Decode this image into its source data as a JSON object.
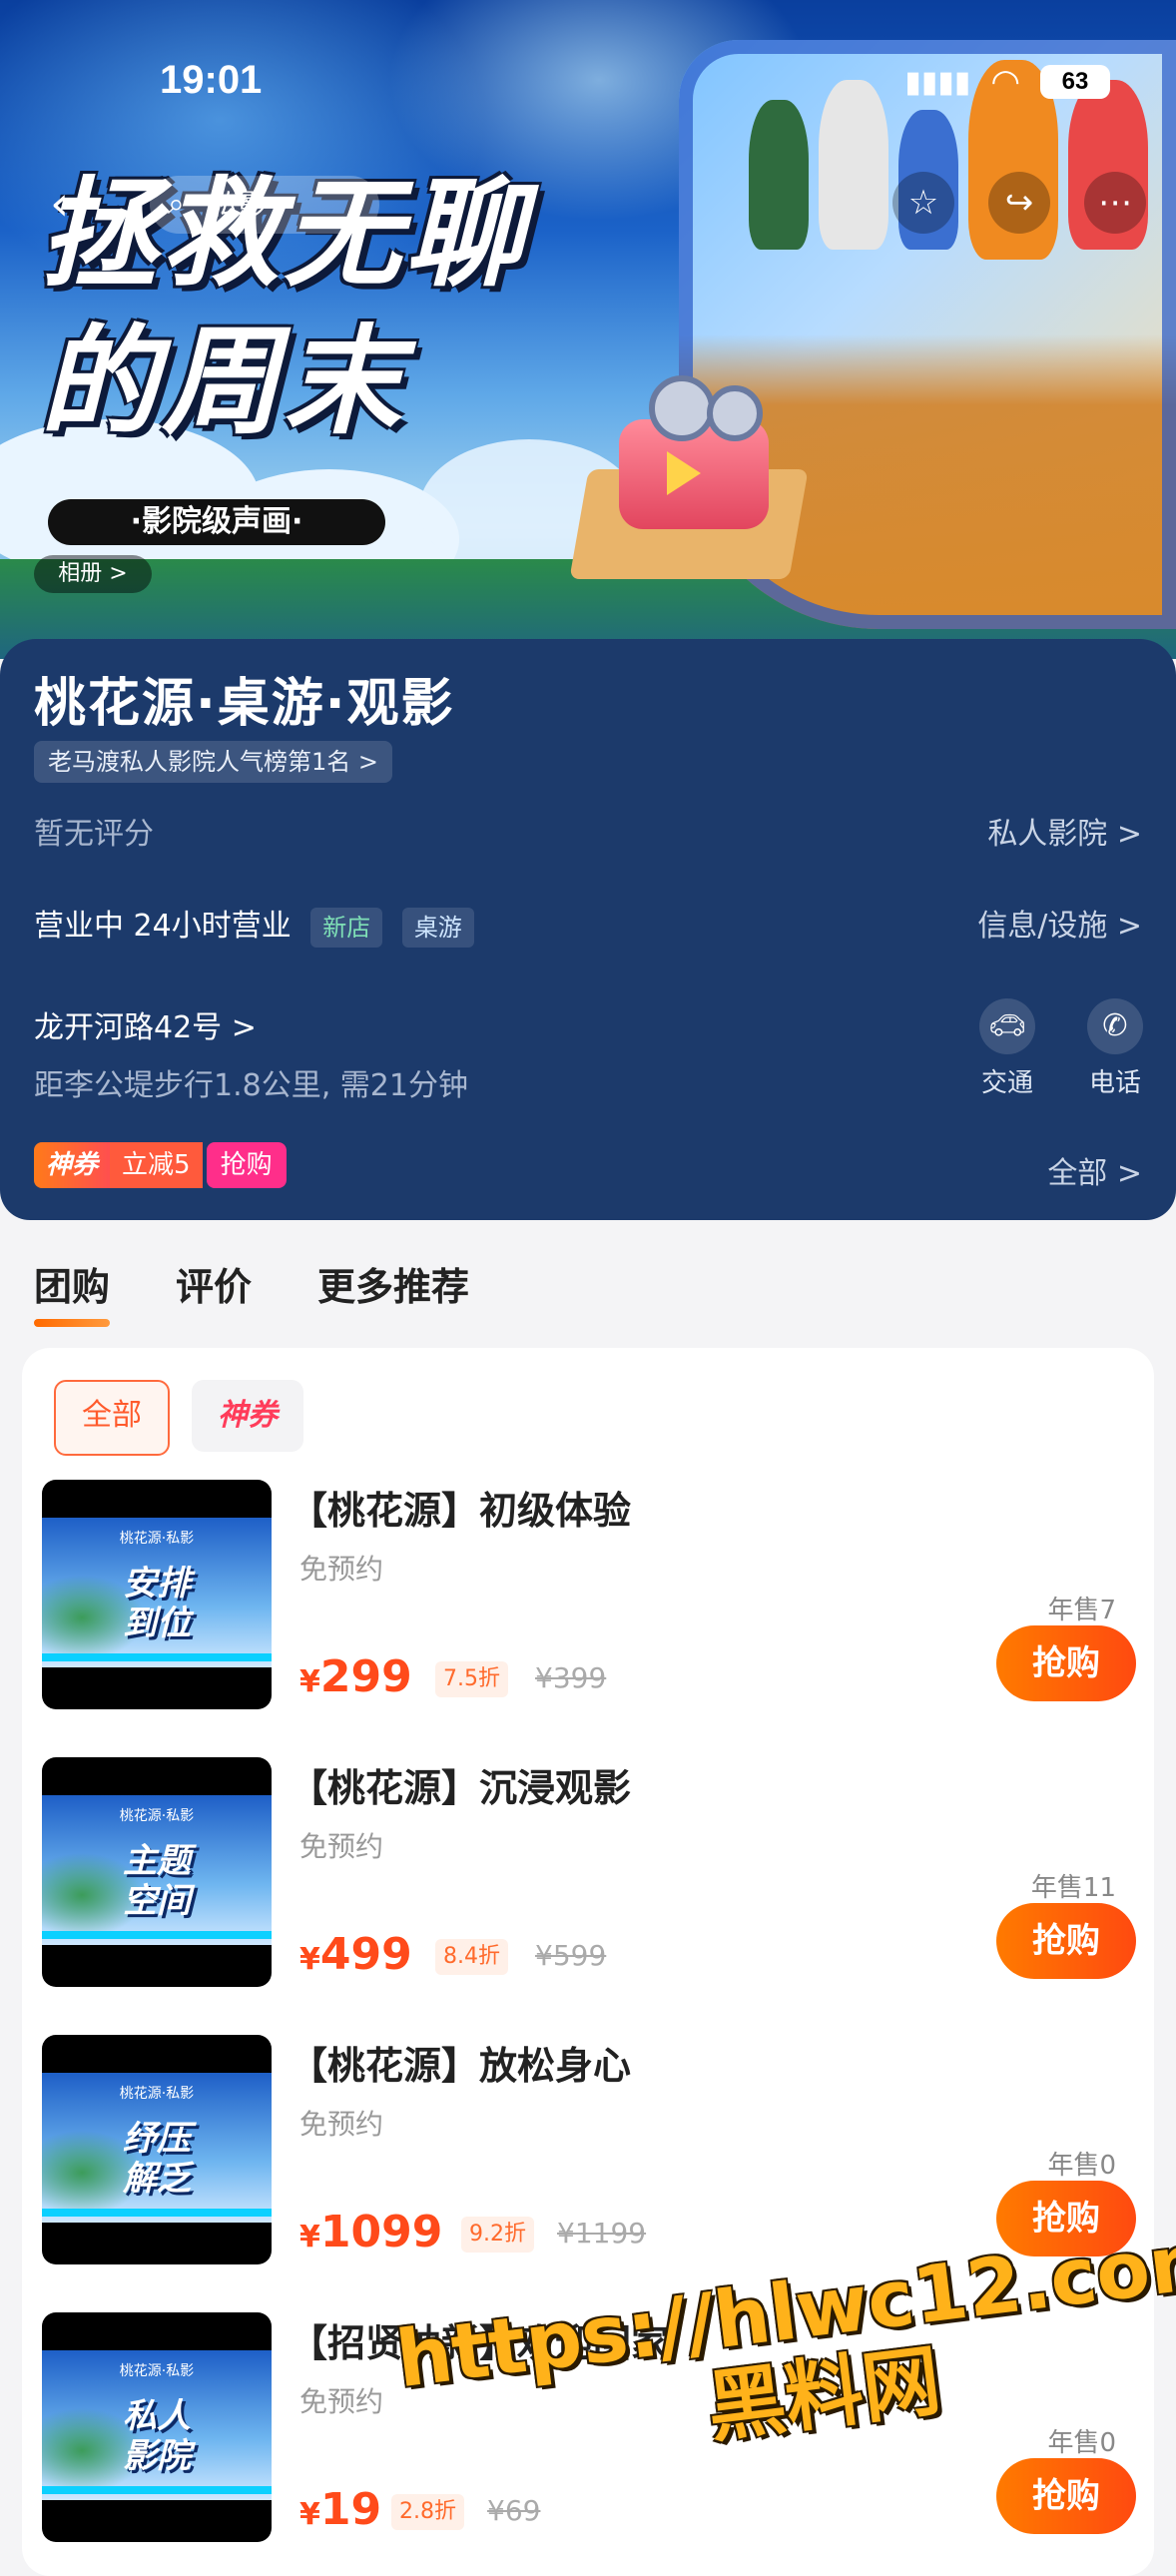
{
  "status_bar": {
    "time": "19:01",
    "battery": "63"
  },
  "nav": {
    "search_placeholder": "私影"
  },
  "hero": {
    "title_line1": "拯救无聊",
    "title_line2": "的周末",
    "pill": "·影院级声画·",
    "album": "相册 >"
  },
  "store": {
    "name": "桃花源·桌游·观影",
    "rank": "老马渡私人影院人气榜第1名 >",
    "rating": "暂无评分",
    "category": "私人影院 >",
    "hours": "营业中 24小时营业",
    "tags": [
      "新店",
      "桌游"
    ],
    "info_link": "信息/设施 >",
    "address": "龙开河路42号 >",
    "distance": "距李公堤步行1.8公里, 需21分钟",
    "actions": {
      "transit": "交通",
      "phone": "电话"
    },
    "coupon": {
      "brand": "神券",
      "discount": "立减5",
      "grab": "抢购"
    },
    "all_link": "全部 >"
  },
  "tabs": [
    "团购",
    "评价",
    "更多推荐"
  ],
  "filters": [
    "全部",
    "神券"
  ],
  "deals": [
    {
      "title": "【桃花源】初级体验",
      "sub": "免预约",
      "price": "299",
      "discount": "7.5折",
      "original": "¥399",
      "sold": "年售7",
      "thumb": "安排\n到位",
      "brand": "桃花源·私影"
    },
    {
      "title": "【桃花源】沉浸观影",
      "sub": "免预约",
      "price": "499",
      "discount": "8.4折",
      "original": "¥599",
      "sold": "年售11",
      "thumb": "主题\n空间",
      "brand": "桃花源·私影"
    },
    {
      "title": "【桃花源】放松身心",
      "sub": "免预约",
      "price": "1099",
      "discount": "9.2折",
      "original": "¥1199",
      "sold": "年售0",
      "thumb": "纾压\n解乏",
      "brand": "桃花源·私影"
    },
    {
      "title": "【招贤纳新】欢迎回家",
      "sub": "免预约",
      "price": "19",
      "discount": "2.8折",
      "original": "¥69",
      "sold": "年售0",
      "thumb": "私人\n影院",
      "brand": "桃花源·私影"
    }
  ],
  "currency": "¥",
  "buy_label": "抢购",
  "watermark": {
    "line1": "https://hlwc12.com",
    "line2": "黑料网"
  }
}
